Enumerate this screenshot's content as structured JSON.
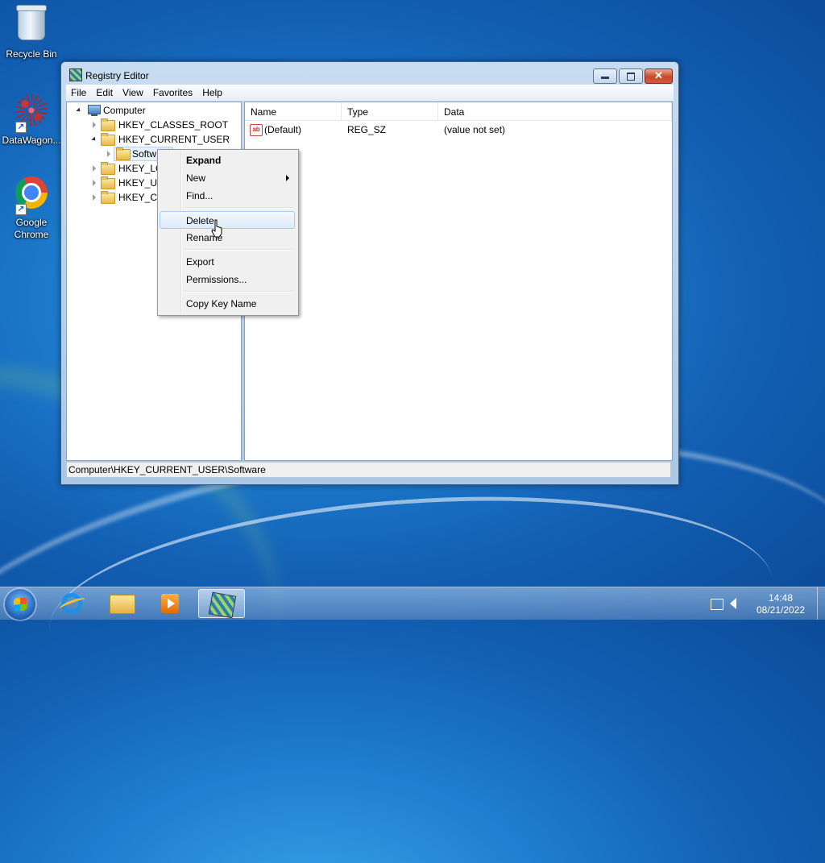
{
  "desktop": {
    "icons": [
      {
        "label": "Recycle Bin"
      },
      {
        "label": "DataWagon..."
      },
      {
        "label": "Google Chrome"
      }
    ]
  },
  "window": {
    "title": "Registry Editor",
    "menu": [
      "File",
      "Edit",
      "View",
      "Favorites",
      "Help"
    ],
    "tree": [
      {
        "label": "Computer",
        "expanded": true
      },
      {
        "label": "HKEY_CLASSES_ROOT"
      },
      {
        "label": "HKEY_CURRENT_USER",
        "expanded": true
      },
      {
        "label": "Softw",
        "selected": true
      },
      {
        "label": "HKEY_LO"
      },
      {
        "label": "HKEY_US"
      },
      {
        "label": "HKEY_CU"
      }
    ],
    "list": {
      "columns": [
        "Name",
        "Type",
        "Data"
      ],
      "rows": [
        {
          "name": "(Default)",
          "type": "REG_SZ",
          "data": "(value not set)",
          "icon": "ab-string-icon"
        }
      ]
    },
    "status": "Computer\\HKEY_CURRENT_USER\\Software"
  },
  "context_menu": {
    "items": [
      {
        "label": "Expand",
        "bold": true
      },
      {
        "label": "New",
        "submenu": true
      },
      {
        "label": "Find..."
      },
      {
        "label": "Delete",
        "highlighted": true
      },
      {
        "label": "Rename"
      },
      {
        "label": "Export"
      },
      {
        "label": "Permissions..."
      },
      {
        "label": "Copy Key Name"
      }
    ]
  },
  "taskbar": {
    "apps": [
      "start-button",
      "internet-explorer",
      "windows-explorer",
      "media-player",
      "registry-editor"
    ],
    "active_app": "registry-editor",
    "clock": {
      "time": "14:48",
      "date": "08/21/2022"
    }
  }
}
